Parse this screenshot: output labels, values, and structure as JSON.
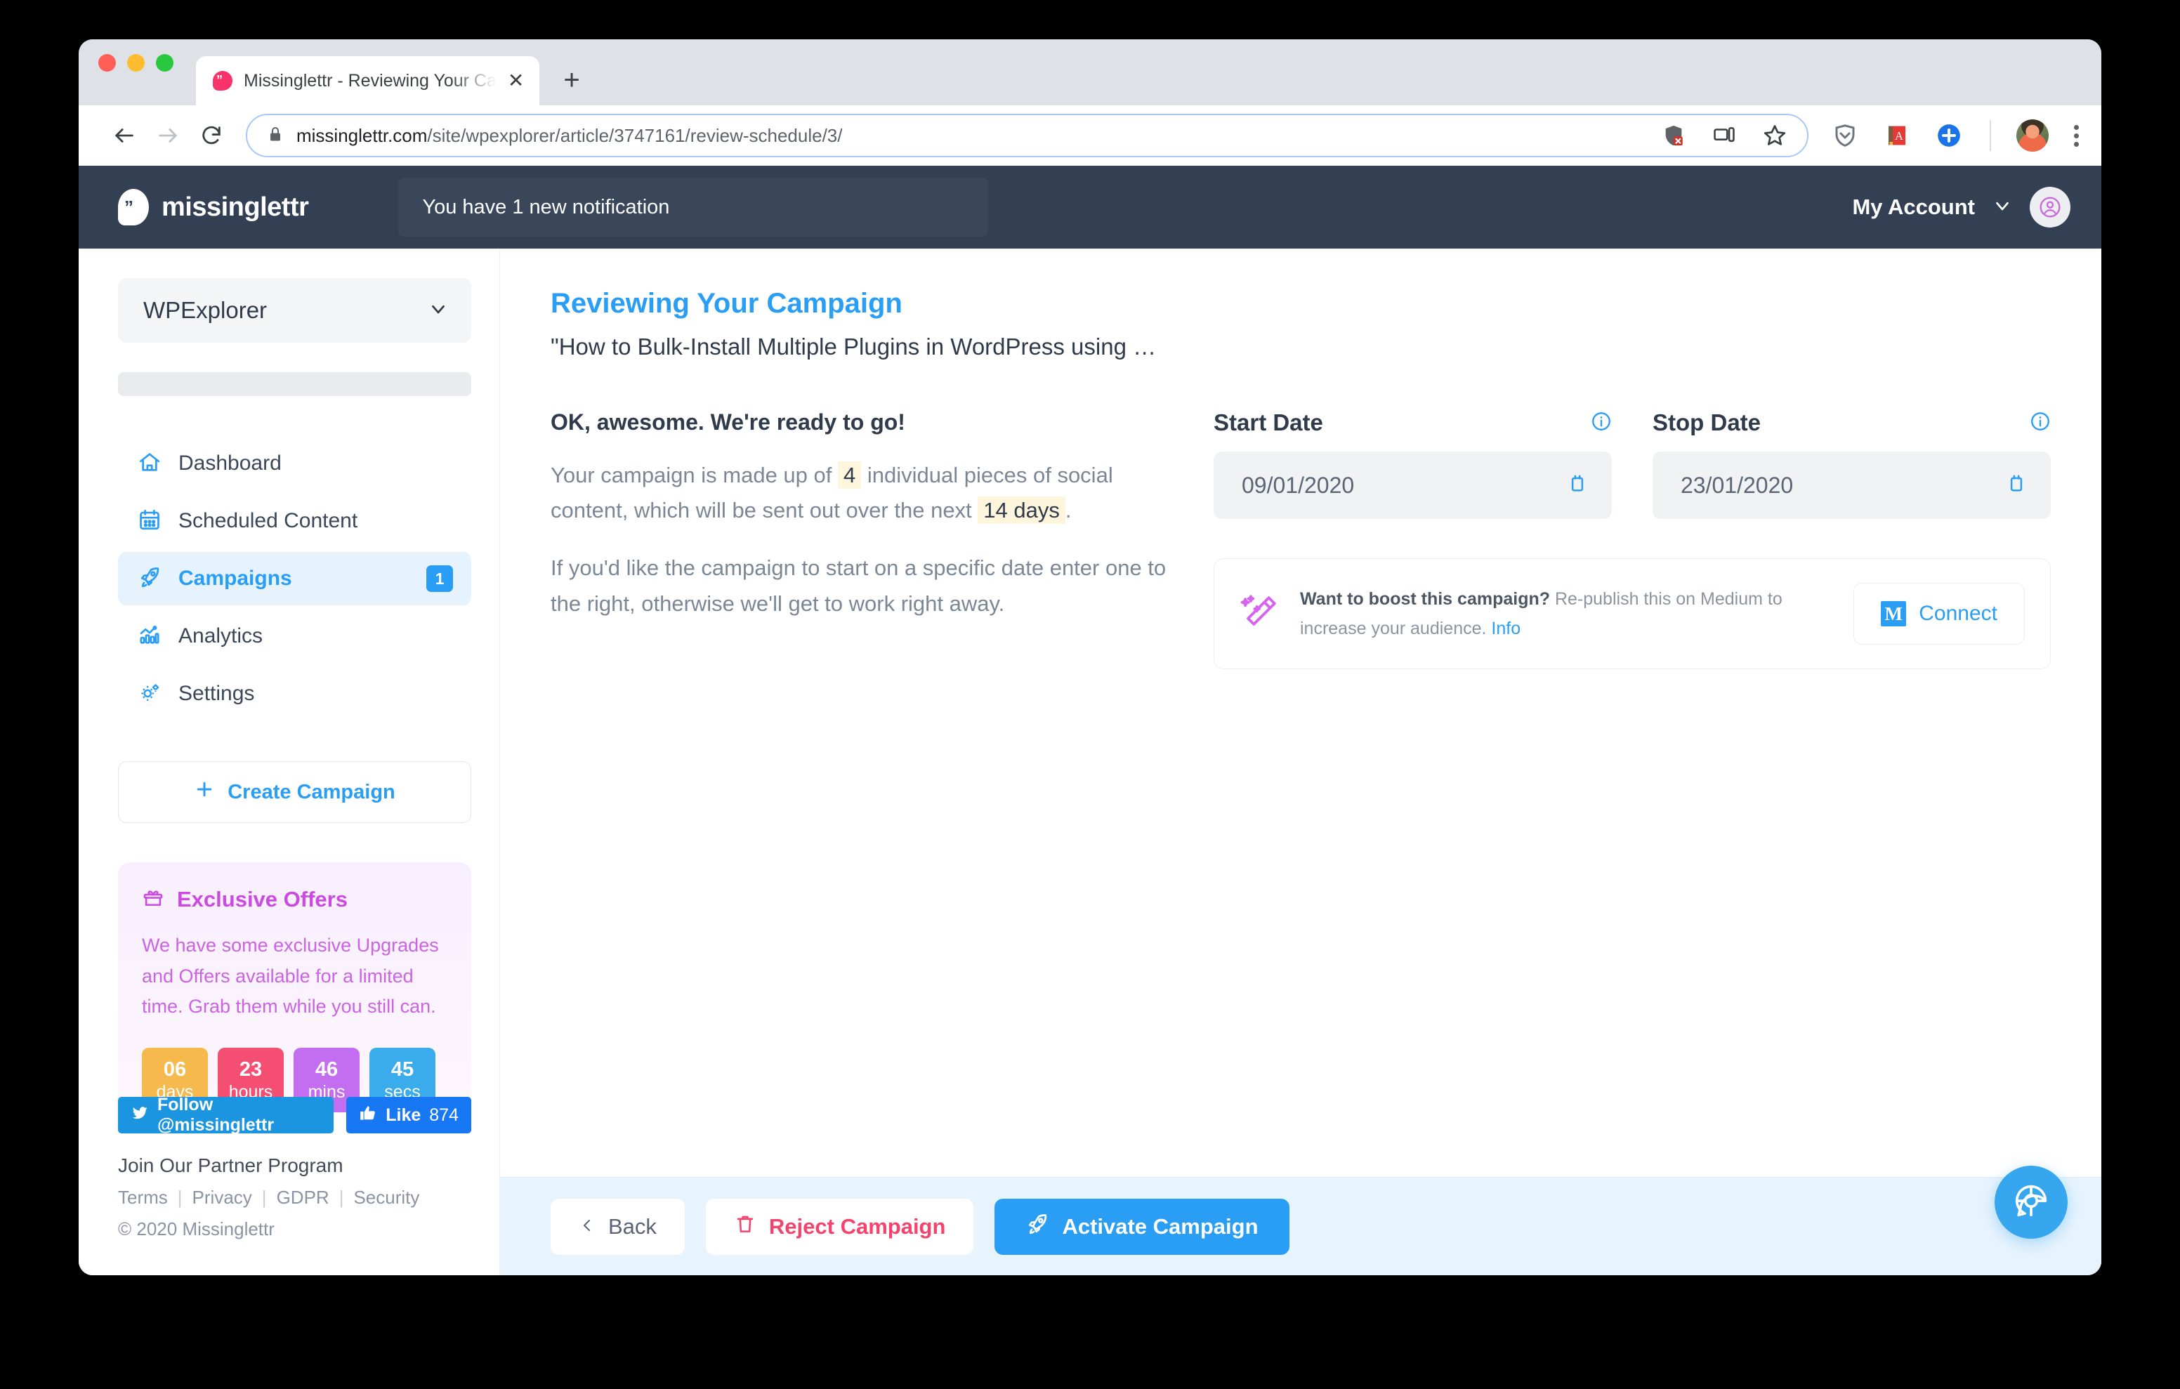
{
  "browser": {
    "tab": {
      "title": "Missinglettr - Reviewing Your Ca",
      "close_label": "✕"
    },
    "new_tab_label": "+",
    "url_domain": "missinglettr.com",
    "url_path": "/site/wpexplorer/article/3747161/review-schedule/3/",
    "icons": {
      "back": "back-arrow-icon",
      "forward": "forward-arrow-icon",
      "reload": "reload-icon",
      "lock": "lock-icon",
      "tracking_blocked": "shield-blocked-icon",
      "cast": "cast-device-icon",
      "bookmark": "star-icon",
      "pocket": "pocket-shield-icon",
      "dictionary": "red-book-icon",
      "add": "blue-plus-icon",
      "profile": "profile-photo-avatar",
      "menu": "three-dot-menu-icon"
    }
  },
  "header": {
    "brand": "missinglettr",
    "brand_mark": "speech-bubble-quote-icon",
    "notification": "You have 1 new notification",
    "account_label": "My Account",
    "account_avatar": "person-circle-icon"
  },
  "sidebar": {
    "site_name": "WPExplorer",
    "nav": [
      {
        "label": "Dashboard",
        "icon": "home-icon",
        "active": false,
        "badge": ""
      },
      {
        "label": "Scheduled Content",
        "icon": "calendar-icon",
        "active": false,
        "badge": ""
      },
      {
        "label": "Campaigns",
        "icon": "rocket-icon",
        "active": true,
        "badge": "1"
      },
      {
        "label": "Analytics",
        "icon": "bar-chart-icon",
        "active": false,
        "badge": ""
      },
      {
        "label": "Settings",
        "icon": "gears-icon",
        "active": false,
        "badge": ""
      }
    ],
    "create_campaign": "Create Campaign",
    "offers": {
      "title": "Exclusive Offers",
      "icon": "gift-icon",
      "body": "We have some exclusive Upgrades and Offers available for a limited time. Grab them while you still can.",
      "countdown": [
        {
          "value": "06",
          "unit": "days",
          "color": "#f5b94d"
        },
        {
          "value": "23",
          "unit": "hours",
          "color": "#f44f72"
        },
        {
          "value": "46",
          "unit": "mins",
          "color": "#c36df0"
        },
        {
          "value": "45",
          "unit": "secs",
          "color": "#3aabeb"
        }
      ]
    },
    "twitter_label": "Follow @missinglettr",
    "like_label": "Like",
    "like_count": "874",
    "partner_link": "Join Our Partner Program",
    "legal_links": [
      "Terms",
      "Privacy",
      "GDPR",
      "Security"
    ],
    "copyright": "© 2020 Missinglettr"
  },
  "main": {
    "title": "Reviewing Your Campaign",
    "subtitle": "\"How to Bulk-Install Multiple Plugins in WordPress using …",
    "lead": "OK, awesome. We're ready to go!",
    "para1_a": "Your campaign is made up of",
    "para1_pieces": "4",
    "para1_b": "individual pieces of social content, which will be sent out over the next",
    "para1_days": "14 days",
    "para1_c": ".",
    "para2": "If you'd like the campaign to start on a specific date enter one to the right, otherwise we'll get to work right away.",
    "start_date_label": "Start Date",
    "start_date_value": "09/01/2020",
    "stop_date_label": "Stop Date",
    "stop_date_value": "23/01/2020",
    "info_icon": "info-circle-icon",
    "calendar_icon": "calendar-icon",
    "boost": {
      "icon": "magic-wand-icon",
      "headline": "Want to boost this campaign?",
      "body": "Re-publish this on Medium to increase your audience.",
      "info_link": "Info",
      "connect_label": "Connect",
      "connect_mark": "M"
    }
  },
  "actions": {
    "back": "Back",
    "back_icon": "chevron-left-icon",
    "reject": "Reject Campaign",
    "reject_icon": "trash-icon",
    "activate": "Activate Campaign",
    "activate_icon": "rocket-icon",
    "support_icon": "lifebuoy-chat-icon"
  },
  "colors": {
    "accent": "#2a9df4",
    "header_bg": "#333f52",
    "danger": "#f4436c",
    "offers": "#cb4ae0"
  }
}
